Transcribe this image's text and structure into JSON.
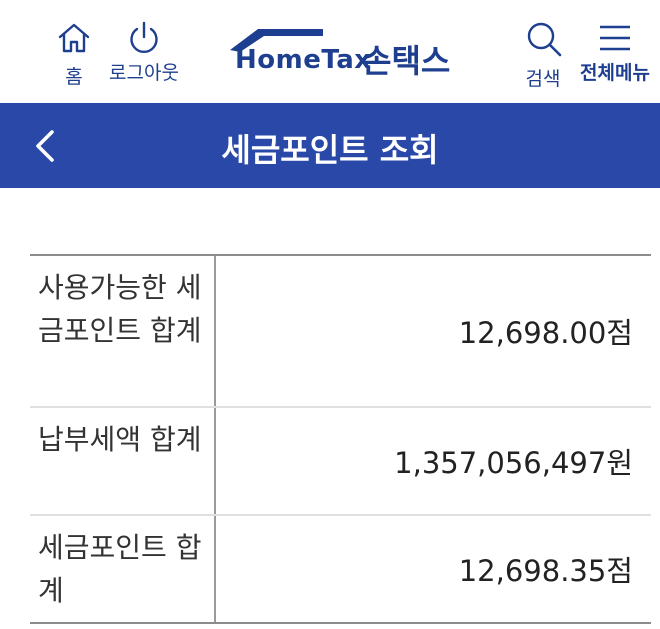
{
  "header": {
    "home_label": "홈",
    "logout_label": "로그아웃",
    "logo_en": "HomeTax",
    "logo_ko": "손택스",
    "search_label": "검색",
    "menu_label": "전체메뉴"
  },
  "titlebar": {
    "title": "세금포인트 조회"
  },
  "table": {
    "rows": [
      {
        "label": "사용가능한 세금포인트 합계",
        "value": "12,698.00점"
      },
      {
        "label": "납부세액 합계",
        "value": "1,357,056,497원"
      },
      {
        "label": "세금포인트 합계",
        "value": "12,698.35점"
      }
    ]
  },
  "colors": {
    "brand": "#2a48a8",
    "text_brand": "#1e3f8f"
  }
}
